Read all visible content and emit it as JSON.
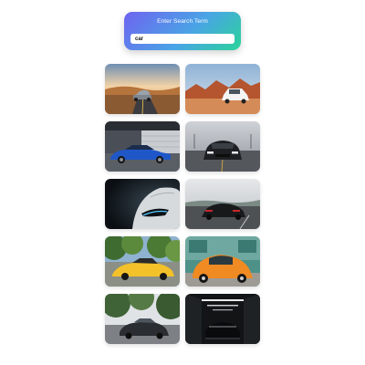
{
  "search": {
    "title": "Enter Search Term",
    "value": "car",
    "placeholder": ""
  },
  "colors": {
    "gradient_start": "#6f63f0",
    "gradient_mid": "#4aa3e6",
    "gradient_end": "#2bd49a"
  },
  "results": [
    {
      "name": "car-photo-1",
      "depicts": "grey sports car on desert road at sunset"
    },
    {
      "name": "car-photo-2",
      "depicts": "white suv on red rock desert"
    },
    {
      "name": "car-photo-3",
      "depicts": "blue coupe in front of garage"
    },
    {
      "name": "car-photo-4",
      "depicts": "black muscle car front view on road"
    },
    {
      "name": "car-photo-5",
      "depicts": "white car headlight in dark"
    },
    {
      "name": "car-photo-6",
      "depicts": "black sports car rear view on road"
    },
    {
      "name": "car-photo-7",
      "depicts": "yellow supercar among trees"
    },
    {
      "name": "car-photo-8",
      "depicts": "orange vintage beetle"
    },
    {
      "name": "car-photo-9",
      "depicts": "dark car under trees"
    },
    {
      "name": "car-photo-10",
      "depicts": "black car in dark tunnel"
    }
  ]
}
